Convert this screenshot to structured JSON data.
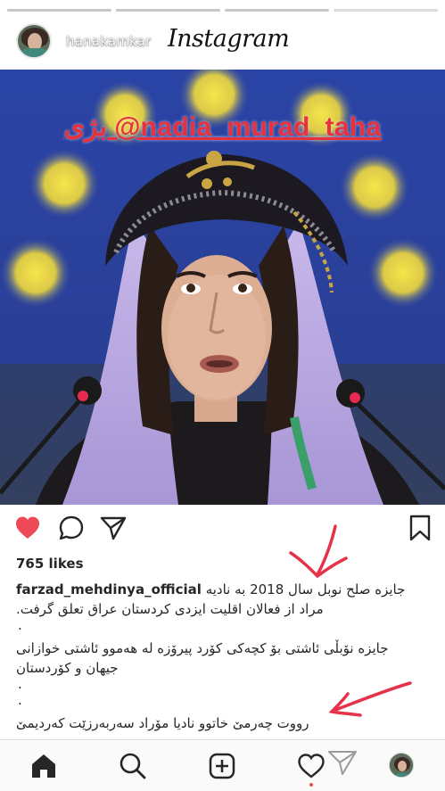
{
  "header": {
    "username": "hanakamkar",
    "app_logo": "Instagram"
  },
  "story": {
    "bars_total": 4
  },
  "post": {
    "overlay_text": "بژی @nadia_murad_taha",
    "likes": "765 likes",
    "caption": {
      "username": "farzad_mehdinya_official",
      "line1": "جایزه صلح نوبل سال 2018 به نادیه",
      "line2": "مراد از فعالان اقلیت ایزدی کردستان عراق تعلق گرفت.",
      "dot1": ".",
      "line3": "جایزە نۆبڵی ئاشتی بۆ کچەکی کۆرد پیرۆزە لە هەموو ئاشتی خوازانی",
      "line4": "جیهان و کۆردستان",
      "dot2": ".",
      "dot3": ".",
      "line5": "رووت چەرمێ خاتوو نادیا مۆراد سەربەرزێت کەردیمێ"
    }
  },
  "icons": {
    "like": "heart-filled-icon",
    "comment": "comment-bubble-icon",
    "share": "paper-plane-icon",
    "save": "bookmark-icon",
    "home": "home-icon",
    "search": "search-icon",
    "create": "plus-square-icon",
    "activity": "heart-outline-icon",
    "profile": "profile-avatar-icon"
  },
  "colors": {
    "like_red": "#ed4956",
    "overlay_red": "#e8313d",
    "annotation_arrow": "#e5334a",
    "text": "#262626"
  }
}
